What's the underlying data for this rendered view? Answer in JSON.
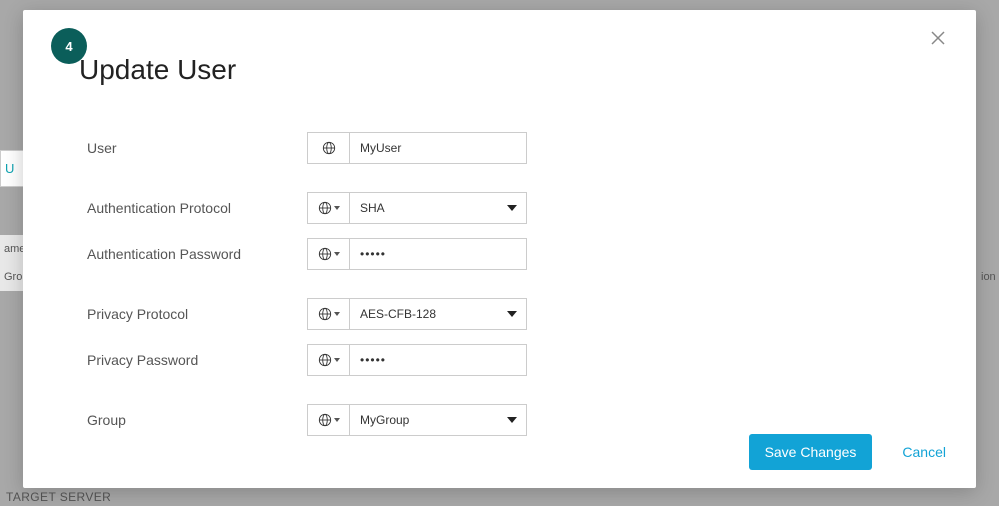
{
  "step": "4",
  "title": "Update User",
  "background": {
    "tab": "U",
    "col_name": "ame",
    "col_group": "Grou",
    "col_ion": "ion",
    "footer": "TARGET SERVER"
  },
  "form": {
    "user": {
      "label": "User",
      "value": "MyUser"
    },
    "auth_proto": {
      "label": "Authentication Protocol",
      "value": "SHA"
    },
    "auth_pwd": {
      "label": "Authentication Password",
      "value": "•••••"
    },
    "priv_proto": {
      "label": "Privacy Protocol",
      "value": "AES-CFB-128"
    },
    "priv_pwd": {
      "label": "Privacy Password",
      "value": "•••••"
    },
    "group": {
      "label": "Group",
      "value": "MyGroup"
    }
  },
  "buttons": {
    "save": "Save Changes",
    "cancel": "Cancel"
  }
}
